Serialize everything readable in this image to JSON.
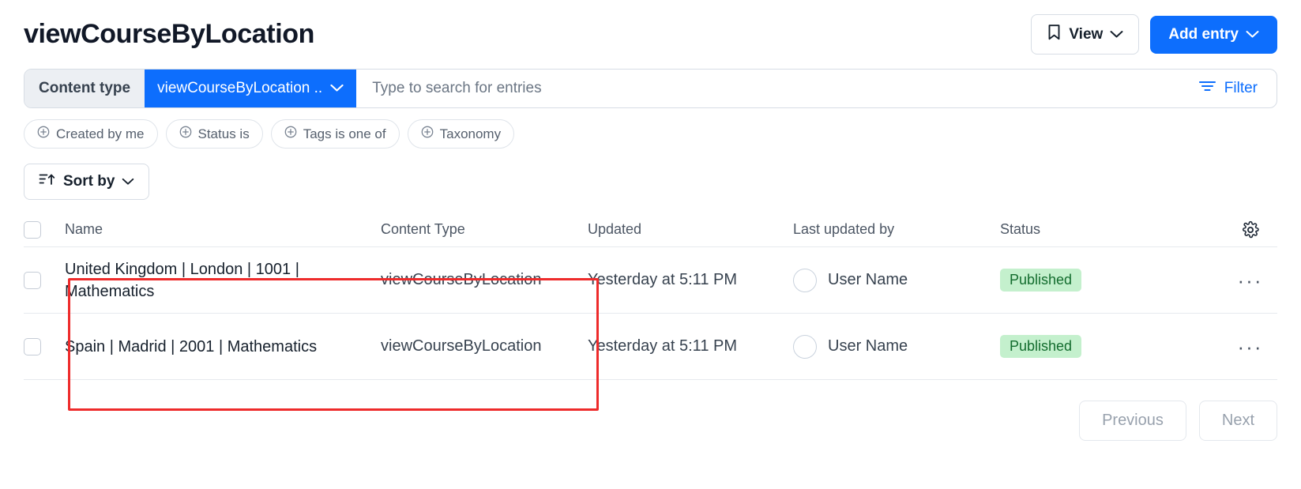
{
  "header": {
    "title": "viewCourseByLocation",
    "view_button": {
      "label": "View",
      "icon": "bookmark-icon",
      "chevron": "⌄"
    },
    "add_button": {
      "label": "Add entry",
      "chevron": "⌄",
      "color": "#0d6efd"
    }
  },
  "search": {
    "content_type_label": "Content type",
    "content_type_value": "viewCourseByLocation ..",
    "content_type_chevron": "⌄",
    "placeholder": "Type to search for entries",
    "value": "",
    "filter_label": "Filter",
    "filter_color": "#0d6efd"
  },
  "chips": [
    {
      "icon": "plus-circle-icon",
      "label": "Created by me"
    },
    {
      "icon": "plus-circle-icon",
      "label": "Status is"
    },
    {
      "icon": "plus-circle-icon",
      "label": "Tags is one of"
    },
    {
      "icon": "plus-circle-icon",
      "label": "Taxonomy"
    }
  ],
  "sort": {
    "label": "Sort by",
    "icon": "sort-ascending-icon",
    "chevron": "⌄"
  },
  "table": {
    "columns": [
      "Name",
      "Content Type",
      "Updated",
      "Last updated by",
      "Status"
    ],
    "settings_icon": "gear-icon",
    "rows": [
      {
        "name": "United Kingdom | London | 1001 | Mathematics",
        "content_type": "viewCourseByLocation",
        "updated": "Yesterday at 5:11 PM",
        "last_updated_by": "User Name",
        "status": "Published",
        "status_color": "#136c2e",
        "menu": "···"
      },
      {
        "name": "Spain | Madrid | 2001 | Mathematics",
        "content_type": "viewCourseByLocation",
        "updated": "Yesterday at 5:11 PM",
        "last_updated_by": "User Name",
        "status": "Published",
        "status_color": "#136c2e",
        "menu": "···"
      }
    ]
  },
  "highlight": {
    "color": "#ee2b2b"
  },
  "pagination": {
    "previous": "Previous",
    "next": "Next"
  }
}
